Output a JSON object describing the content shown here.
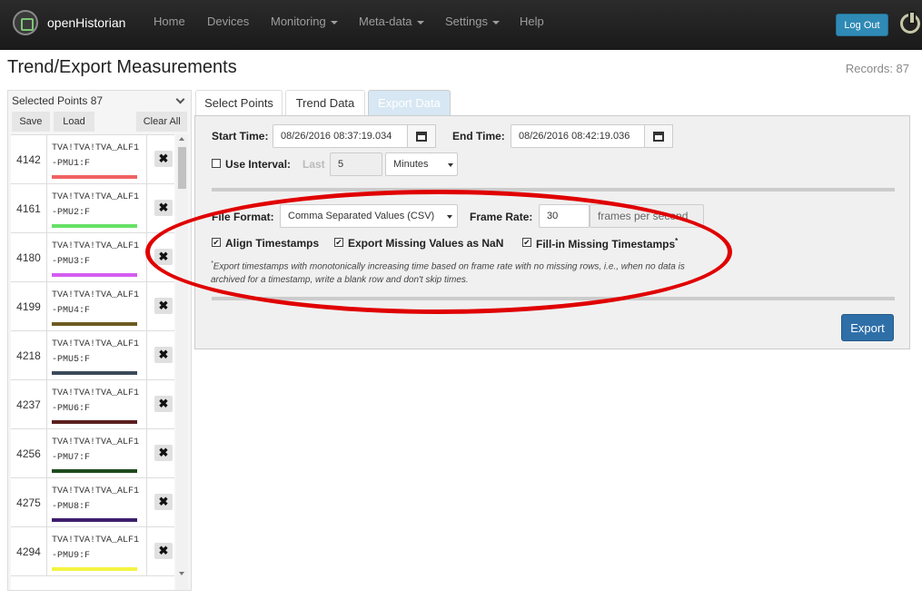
{
  "app": {
    "name": "openHistorian"
  },
  "nav": {
    "items": [
      {
        "label": "Home",
        "dropdown": false
      },
      {
        "label": "Devices",
        "dropdown": false
      },
      {
        "label": "Monitoring",
        "dropdown": true
      },
      {
        "label": "Meta-data",
        "dropdown": true
      },
      {
        "label": "Settings",
        "dropdown": true
      },
      {
        "label": "Help",
        "dropdown": false
      }
    ],
    "logout_label": "Log Out"
  },
  "page": {
    "title": "Trend/Export Measurements",
    "records": "Records: 87"
  },
  "points_panel": {
    "header": "Selected Points 87",
    "save_label": "Save",
    "load_label": "Load",
    "clear_label": "Clear All",
    "remove_glyph": "✖",
    "points": [
      {
        "id": "4142",
        "line1": "TVA!TVA!TVA_ALF1",
        "line2": "-PMU1:F",
        "color": "#f06262"
      },
      {
        "id": "4161",
        "line1": "TVA!TVA!TVA_ALF1",
        "line2": "-PMU2:F",
        "color": "#66e066"
      },
      {
        "id": "4180",
        "line1": "TVA!TVA!TVA_ALF1",
        "line2": "-PMU3:F",
        "color": "#d45cf0"
      },
      {
        "id": "4199",
        "line1": "TVA!TVA!TVA_ALF1",
        "line2": "-PMU4:F",
        "color": "#6b5a21"
      },
      {
        "id": "4218",
        "line1": "TVA!TVA!TVA_ALF1",
        "line2": "-PMU5:F",
        "color": "#3b4a5a"
      },
      {
        "id": "4237",
        "line1": "TVA!TVA!TVA_ALF1",
        "line2": "-PMU6:F",
        "color": "#5a1e1e"
      },
      {
        "id": "4256",
        "line1": "TVA!TVA!TVA_ALF1",
        "line2": "-PMU7:F",
        "color": "#1e4a1e"
      },
      {
        "id": "4275",
        "line1": "TVA!TVA!TVA_ALF1",
        "line2": "-PMU8:F",
        "color": "#3e1e6e"
      },
      {
        "id": "4294",
        "line1": "TVA!TVA!TVA_ALF1",
        "line2": "-PMU9:F",
        "color": "#f4f442"
      }
    ]
  },
  "tabs": [
    {
      "label": "Select Points",
      "active": false
    },
    {
      "label": "Trend Data",
      "active": false
    },
    {
      "label": "Export Data",
      "active": true
    }
  ],
  "export": {
    "start_label": "Start Time:",
    "start_value": "08/26/2016 08:37:19.034",
    "end_label": "End Time:",
    "end_value": "08/26/2016 08:42:19.036",
    "use_interval_label": "Use Interval:",
    "last_label": "Last",
    "interval_value": "5",
    "interval_unit": "Minutes",
    "file_format_label": "File Format:",
    "file_format_value": "Comma Separated Values (CSV)",
    "frame_rate_label": "Frame Rate:",
    "frame_rate_value": "30",
    "frames_suffix": "frames per second",
    "align_label": "Align Timestamps",
    "nan_label": "Export Missing Values as NaN",
    "fill_label": "Fill-in Missing Timestamps",
    "fill_sup": "*",
    "note_star": "*",
    "note": "Export timestamps with monotonically increasing time based on frame rate with no missing rows, i.e., when no data is archived for a timestamp, write a blank row and don't skip times.",
    "export_label": "Export",
    "check_glyph": "✔"
  }
}
